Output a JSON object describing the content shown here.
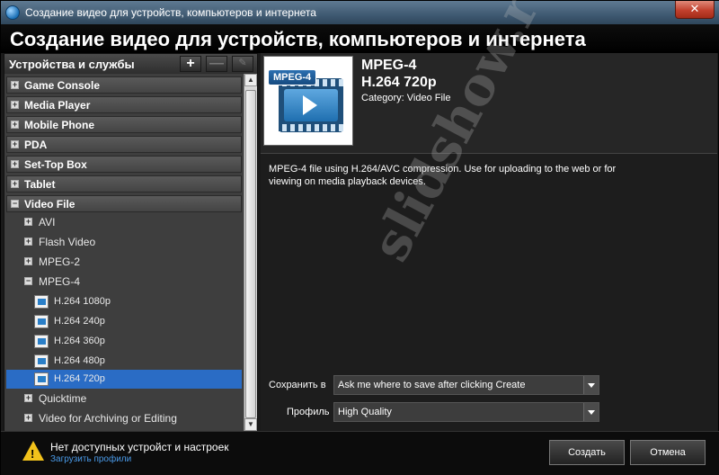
{
  "window": {
    "title": "Создание видео для устройств, компьютеров и интернета",
    "close_label": "✕"
  },
  "header": {
    "title": "Создание видео для устройств, компьютеров и интернета"
  },
  "left_panel": {
    "title": "Устройства и службы",
    "add_label": "+",
    "remove_label": "—",
    "edit_label": "✎",
    "categories": [
      "Game Console",
      "Media Player",
      "Mobile Phone",
      "PDA",
      "Set-Top Box",
      "Tablet",
      "Video File"
    ],
    "subcategories": [
      "AVI",
      "Flash Video",
      "MPEG-2",
      "MPEG-4"
    ],
    "mpeg4_items": [
      "H.264 1080p",
      "H.264 240p",
      "H.264 360p",
      "H.264 480p",
      "H.264 720p"
    ],
    "more_subcategories": [
      "Quicktime",
      "Video for Archiving or Editing"
    ],
    "selected_item": "H.264 720p"
  },
  "details": {
    "badge": "MPEG-4",
    "format_name": "MPEG-4",
    "preset_name": "H.264 720p",
    "category": "Category: Video File",
    "description": "MPEG-4 file using H.264/AVC compression. Use for uploading to the web or for viewing on media playback devices.",
    "save_label": "Сохранить в",
    "save_value": "Ask me where to save after clicking Create",
    "profile_label": "Профиль",
    "profile_value": "High Quality"
  },
  "watermark": "slidshow.ru",
  "footer": {
    "warning_text": "Нет доступных устройст и настроек",
    "warning_mark": "!",
    "link": "Загрузить профили",
    "create_button": "Создать",
    "cancel_button": "Отмена"
  },
  "colors": {
    "selection": "#2a6cc5",
    "warning": "#f2c21b",
    "link": "#4a9ae8"
  }
}
